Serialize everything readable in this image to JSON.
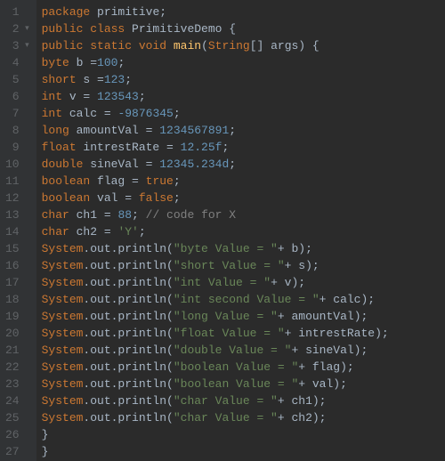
{
  "lines": [
    {
      "n": "1",
      "fold": "",
      "tokens": [
        [
          "kw",
          "package "
        ],
        [
          "txt",
          "primitive;"
        ]
      ]
    },
    {
      "n": "2",
      "fold": "▾",
      "tokens": [
        [
          "kw",
          "public class "
        ],
        [
          "cls",
          "PrimitiveDemo {"
        ]
      ]
    },
    {
      "n": "3",
      "fold": "▾",
      "tokens": [
        [
          "kw",
          "public static void "
        ],
        [
          "fn",
          "main"
        ],
        [
          "txt",
          "("
        ],
        [
          "strType",
          "String"
        ],
        [
          "txt",
          "[] args) {"
        ]
      ]
    },
    {
      "n": "4",
      "fold": "",
      "tokens": [
        [
          "kw",
          "byte "
        ],
        [
          "txt",
          "b ="
        ],
        [
          "num",
          "100"
        ],
        [
          "txt",
          ";"
        ]
      ]
    },
    {
      "n": "5",
      "fold": "",
      "tokens": [
        [
          "kw",
          "short "
        ],
        [
          "txt",
          "s ="
        ],
        [
          "num",
          "123"
        ],
        [
          "txt",
          ";"
        ]
      ]
    },
    {
      "n": "6",
      "fold": "",
      "tokens": [
        [
          "kw",
          "int "
        ],
        [
          "txt",
          "v = "
        ],
        [
          "num",
          "123543"
        ],
        [
          "txt",
          ";"
        ]
      ]
    },
    {
      "n": "7",
      "fold": "",
      "tokens": [
        [
          "kw",
          "int "
        ],
        [
          "txt",
          "calc = "
        ],
        [
          "num",
          "-9876345"
        ],
        [
          "txt",
          ";"
        ]
      ]
    },
    {
      "n": "8",
      "fold": "",
      "tokens": [
        [
          "kw",
          "long "
        ],
        [
          "txt",
          "amountVal = "
        ],
        [
          "num",
          "1234567891"
        ],
        [
          "txt",
          ";"
        ]
      ]
    },
    {
      "n": "9",
      "fold": "",
      "tokens": [
        [
          "kw",
          "float "
        ],
        [
          "txt",
          "intrestRate = "
        ],
        [
          "num",
          "12.25f"
        ],
        [
          "txt",
          ";"
        ]
      ]
    },
    {
      "n": "10",
      "fold": "",
      "tokens": [
        [
          "kw",
          "double "
        ],
        [
          "txt",
          "sineVal = "
        ],
        [
          "num",
          "12345.234d"
        ],
        [
          "txt",
          ";"
        ]
      ]
    },
    {
      "n": "11",
      "fold": "",
      "tokens": [
        [
          "kw",
          "boolean "
        ],
        [
          "txt",
          "flag = "
        ],
        [
          "kw",
          "true"
        ],
        [
          "txt",
          ";"
        ]
      ]
    },
    {
      "n": "12",
      "fold": "",
      "tokens": [
        [
          "kw",
          "boolean "
        ],
        [
          "txt",
          "val = "
        ],
        [
          "kw",
          "false"
        ],
        [
          "txt",
          ";"
        ]
      ]
    },
    {
      "n": "13",
      "fold": "",
      "tokens": [
        [
          "kw",
          "char "
        ],
        [
          "txt",
          "ch1 = "
        ],
        [
          "num",
          "88"
        ],
        [
          "txt",
          "; "
        ],
        [
          "com",
          "// code for X"
        ]
      ]
    },
    {
      "n": "14",
      "fold": "",
      "tokens": [
        [
          "kw",
          "char "
        ],
        [
          "txt",
          "ch2 = "
        ],
        [
          "str",
          "'Y'"
        ],
        [
          "txt",
          ";"
        ]
      ]
    },
    {
      "n": "15",
      "fold": "",
      "tokens": [
        [
          "sysr",
          "System"
        ],
        [
          "txt",
          ".out.println("
        ],
        [
          "str",
          "\"byte Value = \""
        ],
        [
          "txt",
          "+ b);"
        ]
      ]
    },
    {
      "n": "16",
      "fold": "",
      "tokens": [
        [
          "sysr",
          "System"
        ],
        [
          "txt",
          ".out.println("
        ],
        [
          "str",
          "\"short Value = \""
        ],
        [
          "txt",
          "+ s);"
        ]
      ]
    },
    {
      "n": "17",
      "fold": "",
      "tokens": [
        [
          "sysr",
          "System"
        ],
        [
          "txt",
          ".out.println("
        ],
        [
          "str",
          "\"int Value = \""
        ],
        [
          "txt",
          "+ v);"
        ]
      ]
    },
    {
      "n": "18",
      "fold": "",
      "tokens": [
        [
          "sysr",
          "System"
        ],
        [
          "txt",
          ".out.println("
        ],
        [
          "str",
          "\"int second Value = \""
        ],
        [
          "txt",
          "+ calc);"
        ]
      ]
    },
    {
      "n": "19",
      "fold": "",
      "tokens": [
        [
          "sysr",
          "System"
        ],
        [
          "txt",
          ".out.println("
        ],
        [
          "str",
          "\"long Value = \""
        ],
        [
          "txt",
          "+ amountVal);"
        ]
      ]
    },
    {
      "n": "20",
      "fold": "",
      "tokens": [
        [
          "sysr",
          "System"
        ],
        [
          "txt",
          ".out.println("
        ],
        [
          "str",
          "\"float Value = \""
        ],
        [
          "txt",
          "+ intrestRate);"
        ]
      ]
    },
    {
      "n": "21",
      "fold": "",
      "tokens": [
        [
          "sysr",
          "System"
        ],
        [
          "txt",
          ".out.println("
        ],
        [
          "str",
          "\"double Value = \""
        ],
        [
          "txt",
          "+ sineVal);"
        ]
      ]
    },
    {
      "n": "22",
      "fold": "",
      "tokens": [
        [
          "sysr",
          "System"
        ],
        [
          "txt",
          ".out.println("
        ],
        [
          "str",
          "\"boolean Value = \""
        ],
        [
          "txt",
          "+ flag);"
        ]
      ]
    },
    {
      "n": "23",
      "fold": "",
      "tokens": [
        [
          "sysr",
          "System"
        ],
        [
          "txt",
          ".out.println("
        ],
        [
          "str",
          "\"boolean Value = \""
        ],
        [
          "txt",
          "+ val);"
        ]
      ]
    },
    {
      "n": "24",
      "fold": "",
      "tokens": [
        [
          "sysr",
          "System"
        ],
        [
          "txt",
          ".out.println("
        ],
        [
          "str",
          "\"char Value = \""
        ],
        [
          "txt",
          "+ ch1);"
        ]
      ]
    },
    {
      "n": "25",
      "fold": "",
      "tokens": [
        [
          "sysr",
          "System"
        ],
        [
          "txt",
          ".out.println("
        ],
        [
          "str",
          "\"char Value = \""
        ],
        [
          "txt",
          "+ ch2);"
        ]
      ]
    },
    {
      "n": "26",
      "fold": "",
      "tokens": [
        [
          "txt",
          "}"
        ]
      ]
    },
    {
      "n": "27",
      "fold": "",
      "tokens": [
        [
          "txt",
          "}"
        ]
      ]
    }
  ]
}
